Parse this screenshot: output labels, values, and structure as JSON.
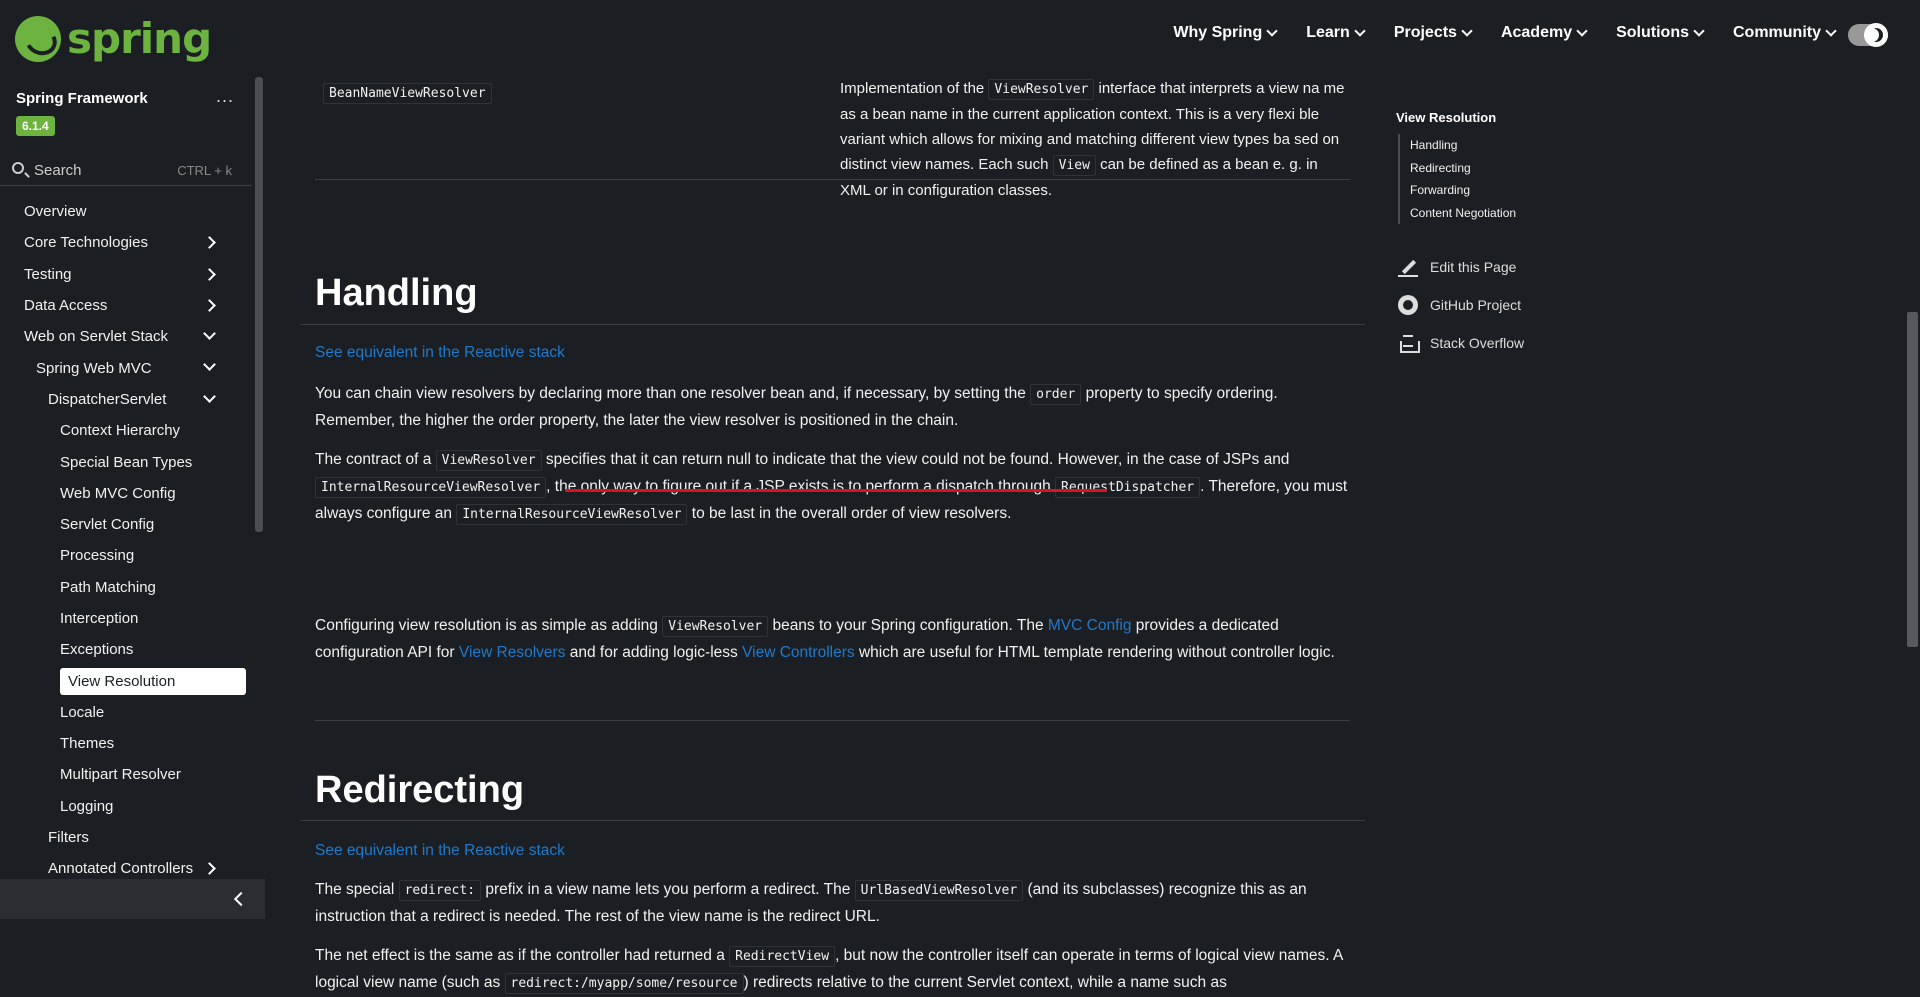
{
  "header": {
    "logo_text": "spring",
    "nav": [
      {
        "label": "Why Spring"
      },
      {
        "label": "Learn"
      },
      {
        "label": "Projects"
      },
      {
        "label": "Academy"
      },
      {
        "label": "Solutions"
      },
      {
        "label": "Community"
      }
    ]
  },
  "sidebar": {
    "title": "Spring Framework",
    "dots": "...",
    "version": "6.1.4",
    "search_label": "Search",
    "search_shortcut": "CTRL + k",
    "items": [
      {
        "label": "Overview",
        "indent": 0,
        "arrow": ""
      },
      {
        "label": "Core Technologies",
        "indent": 0,
        "arrow": "right"
      },
      {
        "label": "Testing",
        "indent": 0,
        "arrow": "right"
      },
      {
        "label": "Data Access",
        "indent": 0,
        "arrow": "right"
      },
      {
        "label": "Web on Servlet Stack",
        "indent": 0,
        "arrow": "down"
      },
      {
        "label": "Spring Web MVC",
        "indent": 1,
        "arrow": "down"
      },
      {
        "label": "DispatcherServlet",
        "indent": 2,
        "arrow": "down"
      },
      {
        "label": "Context Hierarchy",
        "indent": 3,
        "arrow": ""
      },
      {
        "label": "Special Bean Types",
        "indent": 3,
        "arrow": ""
      },
      {
        "label": "Web MVC Config",
        "indent": 3,
        "arrow": ""
      },
      {
        "label": "Servlet Config",
        "indent": 3,
        "arrow": ""
      },
      {
        "label": "Processing",
        "indent": 3,
        "arrow": ""
      },
      {
        "label": "Path Matching",
        "indent": 3,
        "arrow": ""
      },
      {
        "label": "Interception",
        "indent": 3,
        "arrow": ""
      },
      {
        "label": "Exceptions",
        "indent": 3,
        "arrow": ""
      },
      {
        "label": "View Resolution",
        "indent": 3,
        "arrow": "",
        "active": true
      },
      {
        "label": "Locale",
        "indent": 3,
        "arrow": ""
      },
      {
        "label": "Themes",
        "indent": 3,
        "arrow": ""
      },
      {
        "label": "Multipart Resolver",
        "indent": 3,
        "arrow": ""
      },
      {
        "label": "Logging",
        "indent": 3,
        "arrow": ""
      },
      {
        "label": "Filters",
        "indent": 2,
        "arrow": ""
      },
      {
        "label": "Annotated Controllers",
        "indent": 2,
        "arrow": "right"
      }
    ]
  },
  "content": {
    "row1_code": "BeanNameViewResolver",
    "row1_desc_a": "Implementation of the ",
    "row1_desc_code1": "ViewResolver",
    "row1_desc_b": " interface that interprets a view na me as a bean name in the current application context. This is a very flexi ble variant which allows for mixing and matching different view types ba sed on distinct view names. Each such ",
    "row1_desc_code2": "View",
    "row1_desc_c": " can be defined as a bean e. g. in XML or in configuration classes.",
    "handling_title": "Handling",
    "reactive_link": "See equivalent in the Reactive stack",
    "p1_a": "You can chain view resolvers by declaring more than one resolver bean and, if necessary, by setting the ",
    "p1_code": "order",
    "p1_b": " property to specify ordering. Remember, the higher the order property, the later the view resolver is positioned in the chain.",
    "p2_a": "The contract of a ",
    "p2_code1": "ViewResolver",
    "p2_b": " specifies that it can return null to indicate that the view could not be found. However, in the case of JSPs and ",
    "p2_code2": "InternalResourceViewResolver",
    "p2_c": ", the only way to figure out if a JSP exists is to perform a dispatch through ",
    "p2_code3": "RequestDispatcher",
    "p2_d": ". Therefore, you must always configure an ",
    "p2_code4": "InternalResourceViewResolver",
    "p2_e": " to be last in the overall order of view resolvers.",
    "p3_a": "Configuring view resolution is as simple as adding ",
    "p3_code": "ViewResolver",
    "p3_b": " beans to your Spring configuration. The ",
    "p3_link1": "MVC Config",
    "p3_c": " provides a dedicated configuration API for ",
    "p3_link2": "View Resolvers",
    "p3_d": " and for adding logic-less ",
    "p3_link3": "View Controllers",
    "p3_e": " which are useful for HTML template rendering without controller logic.",
    "redirecting_title": "Redirecting",
    "reactive_link2": "See equivalent in the Reactive stack",
    "p4_a": "The special ",
    "p4_code1": "redirect:",
    "p4_b": " prefix in a view name lets you perform a redirect. The ",
    "p4_code2": "UrlBasedViewResolver",
    "p4_c": " (and its subclasses) recognize this as an instruction that a redirect is needed. The rest of the view name is the redirect URL.",
    "p5_a": "The net effect is the same as if the controller had returned a ",
    "p5_code1": "RedirectView",
    "p5_b": ", but now the controller itself can operate in terms of logical view names. A logical view name (such as ",
    "p5_code2": "redirect:/myapp/some/resource",
    "p5_c": ") redirects relative to the current Servlet context, while a name such as"
  },
  "toc": {
    "title": "View Resolution",
    "items": [
      "Handling",
      "Redirecting",
      "Forwarding",
      "Content Negotiation"
    ],
    "links": [
      {
        "label": "Edit this Page",
        "icon": "pencil-icon"
      },
      {
        "label": "GitHub Project",
        "icon": "github-icon"
      },
      {
        "label": "Stack Overflow",
        "icon": "stack-icon"
      }
    ]
  },
  "colors": {
    "brand": "#6db33f",
    "link": "#1f7acb",
    "highlight_underline": "#e0101e"
  }
}
